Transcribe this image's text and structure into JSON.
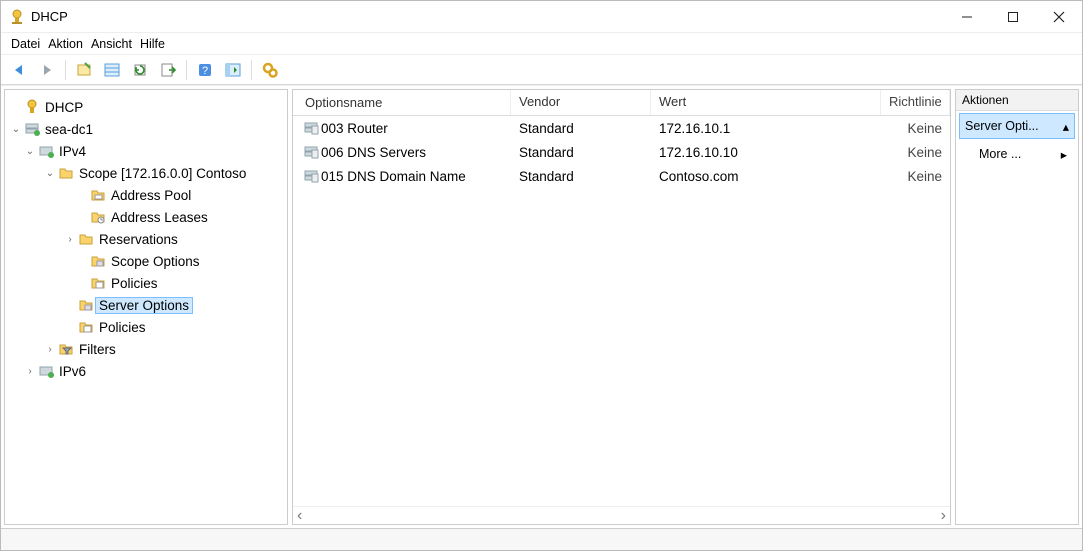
{
  "window": {
    "title": "DHCP"
  },
  "menu": {
    "datei": "Datei",
    "aktion": "Aktion",
    "ansicht": "Ansicht",
    "hilfe": "Hilfe"
  },
  "toolbar_icons": {
    "back": "back-arrow",
    "forward": "forward-arrow",
    "up": "properties",
    "list": "list-view",
    "refresh": "refresh",
    "export": "export-list",
    "help": "help",
    "show_hide": "show-hide-pane",
    "configure": "configure-options"
  },
  "tree": {
    "root": "DHCP",
    "server": "sea-dc1",
    "ipv4": "IPv4",
    "scope": "Scope [172.16.0.0] Contoso",
    "address_pool": "Address Pool",
    "address_leases": "Address Leases",
    "reservations": "Reservations",
    "scope_options": "Scope Options",
    "scope_policies": "Policies",
    "server_options": "Server Options",
    "policies": "Policies",
    "filters": "Filters",
    "ipv6": "IPv6"
  },
  "list": {
    "headers": {
      "name": "Optionsname",
      "vendor": "Vendor",
      "value": "Wert",
      "policy": "Richtlinie"
    },
    "rows": [
      {
        "name": "003 Router",
        "vendor": "Standard",
        "value": "172.16.10.1",
        "policy": "Keine"
      },
      {
        "name": "006 DNS Servers",
        "vendor": "Standard",
        "value": "172.16.10.10",
        "policy": "Keine"
      },
      {
        "name": "015 DNS Domain Name",
        "vendor": "Standard",
        "value": "Contoso.com",
        "policy": "Keine"
      }
    ]
  },
  "actions": {
    "header": "Aktionen",
    "selected": "Server Opti...",
    "more": "More ..."
  }
}
